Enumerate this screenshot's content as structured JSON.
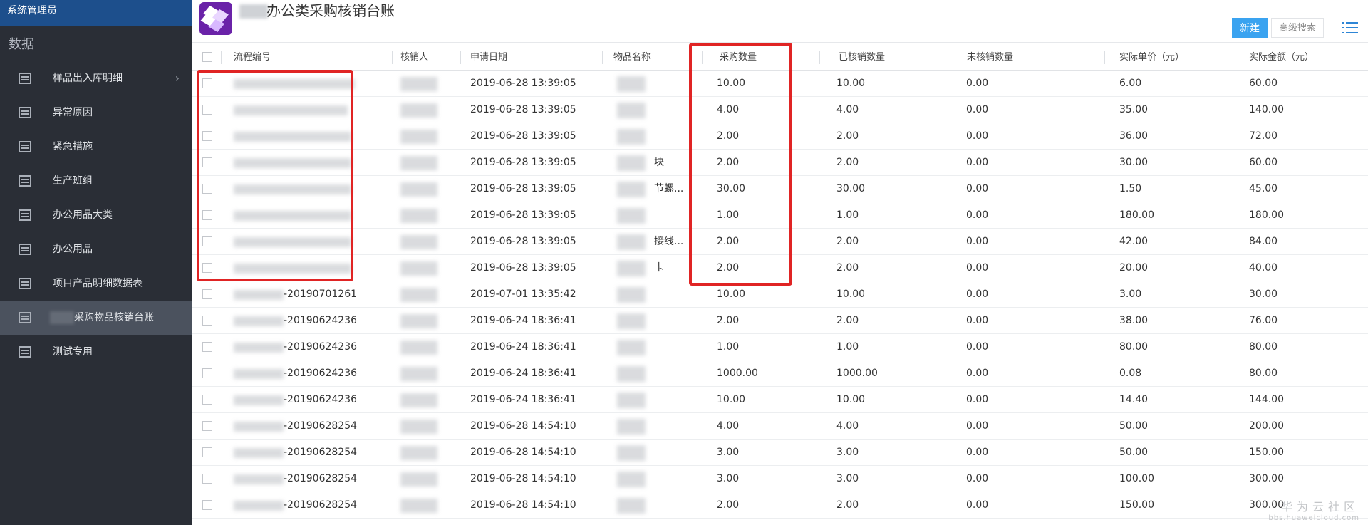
{
  "sidebar": {
    "user": "系统管理员",
    "section": "数据",
    "items": [
      {
        "label": "样品出入库明细",
        "chevron": "›"
      },
      {
        "label": "异常原因"
      },
      {
        "label": "紧急措施"
      },
      {
        "label": "生产班组"
      },
      {
        "label": "办公用品大类"
      },
      {
        "label": "办公用品"
      },
      {
        "label": "项目产品明细数据表"
      },
      {
        "label": "采购物品核销台账",
        "active": true
      },
      {
        "label": "测试专用"
      }
    ]
  },
  "header": {
    "title": "办公类采购核销台账",
    "new_button": "新建",
    "advanced_search": "高级搜索"
  },
  "table": {
    "columns": [
      "流程编号",
      "核销人",
      "申请日期",
      "物品名称",
      "采购数量",
      "已核销数量",
      "未核销数量",
      "实际单价（元）",
      "实际金额（元）"
    ],
    "rows": [
      {
        "flow": "",
        "item": "",
        "date": "2019-06-28 13:39:05",
        "qty": "10.00",
        "done": "10.00",
        "open": "0.00",
        "unit": "6.00",
        "amount": "60.00"
      },
      {
        "flow": "",
        "item": "",
        "date": "2019-06-28 13:39:05",
        "qty": "4.00",
        "done": "4.00",
        "open": "0.00",
        "unit": "35.00",
        "amount": "140.00"
      },
      {
        "flow": "",
        "item": "",
        "date": "2019-06-28 13:39:05",
        "qty": "2.00",
        "done": "2.00",
        "open": "0.00",
        "unit": "36.00",
        "amount": "72.00"
      },
      {
        "flow": "",
        "item": "块",
        "date": "2019-06-28 13:39:05",
        "qty": "2.00",
        "done": "2.00",
        "open": "0.00",
        "unit": "30.00",
        "amount": "60.00"
      },
      {
        "flow": "",
        "item": "节螺...",
        "date": "2019-06-28 13:39:05",
        "qty": "30.00",
        "done": "30.00",
        "open": "0.00",
        "unit": "1.50",
        "amount": "45.00"
      },
      {
        "flow": "",
        "item": "",
        "date": "2019-06-28 13:39:05",
        "qty": "1.00",
        "done": "1.00",
        "open": "0.00",
        "unit": "180.00",
        "amount": "180.00"
      },
      {
        "flow": "",
        "item": "接线...",
        "date": "2019-06-28 13:39:05",
        "qty": "2.00",
        "done": "2.00",
        "open": "0.00",
        "unit": "42.00",
        "amount": "84.00"
      },
      {
        "flow": "",
        "item": "卡",
        "date": "2019-06-28 13:39:05",
        "qty": "2.00",
        "done": "2.00",
        "open": "0.00",
        "unit": "20.00",
        "amount": "40.00"
      },
      {
        "flow": "-20190701261",
        "item": "",
        "date": "2019-07-01 13:35:42",
        "qty": "10.00",
        "done": "10.00",
        "open": "0.00",
        "unit": "3.00",
        "amount": "30.00"
      },
      {
        "flow": "-20190624236",
        "item": "",
        "date": "2019-06-24 18:36:41",
        "qty": "2.00",
        "done": "2.00",
        "open": "0.00",
        "unit": "38.00",
        "amount": "76.00"
      },
      {
        "flow": "-20190624236",
        "item": "",
        "date": "2019-06-24 18:36:41",
        "qty": "1.00",
        "done": "1.00",
        "open": "0.00",
        "unit": "80.00",
        "amount": "80.00"
      },
      {
        "flow": "-20190624236",
        "item": "",
        "date": "2019-06-24 18:36:41",
        "qty": "1000.00",
        "done": "1000.00",
        "open": "0.00",
        "unit": "0.08",
        "amount": "80.00"
      },
      {
        "flow": "-20190624236",
        "item": "",
        "date": "2019-06-24 18:36:41",
        "qty": "10.00",
        "done": "10.00",
        "open": "0.00",
        "unit": "14.40",
        "amount": "144.00"
      },
      {
        "flow": "-20190628254",
        "item": "",
        "date": "2019-06-28 14:54:10",
        "qty": "4.00",
        "done": "4.00",
        "open": "0.00",
        "unit": "50.00",
        "amount": "200.00"
      },
      {
        "flow": "-20190628254",
        "item": "",
        "date": "2019-06-28 14:54:10",
        "qty": "3.00",
        "done": "3.00",
        "open": "0.00",
        "unit": "50.00",
        "amount": "150.00"
      },
      {
        "flow": "-20190628254",
        "item": "",
        "date": "2019-06-28 14:54:10",
        "qty": "3.00",
        "done": "3.00",
        "open": "0.00",
        "unit": "100.00",
        "amount": "300.00"
      },
      {
        "flow": "-20190628254",
        "item": "",
        "date": "2019-06-28 14:54:10",
        "qty": "2.00",
        "done": "2.00",
        "open": "0.00",
        "unit": "150.00",
        "amount": "300.00"
      }
    ]
  },
  "watermark": {
    "main": "华为云社区",
    "sub": "bbs.huaweicloud.com"
  },
  "colors": {
    "sidebar": "#2a2e36",
    "sidebar_active": "#4b525e",
    "primary": "#3aa3f0",
    "highlight": "#e02424",
    "logo": "#6a22a8"
  }
}
